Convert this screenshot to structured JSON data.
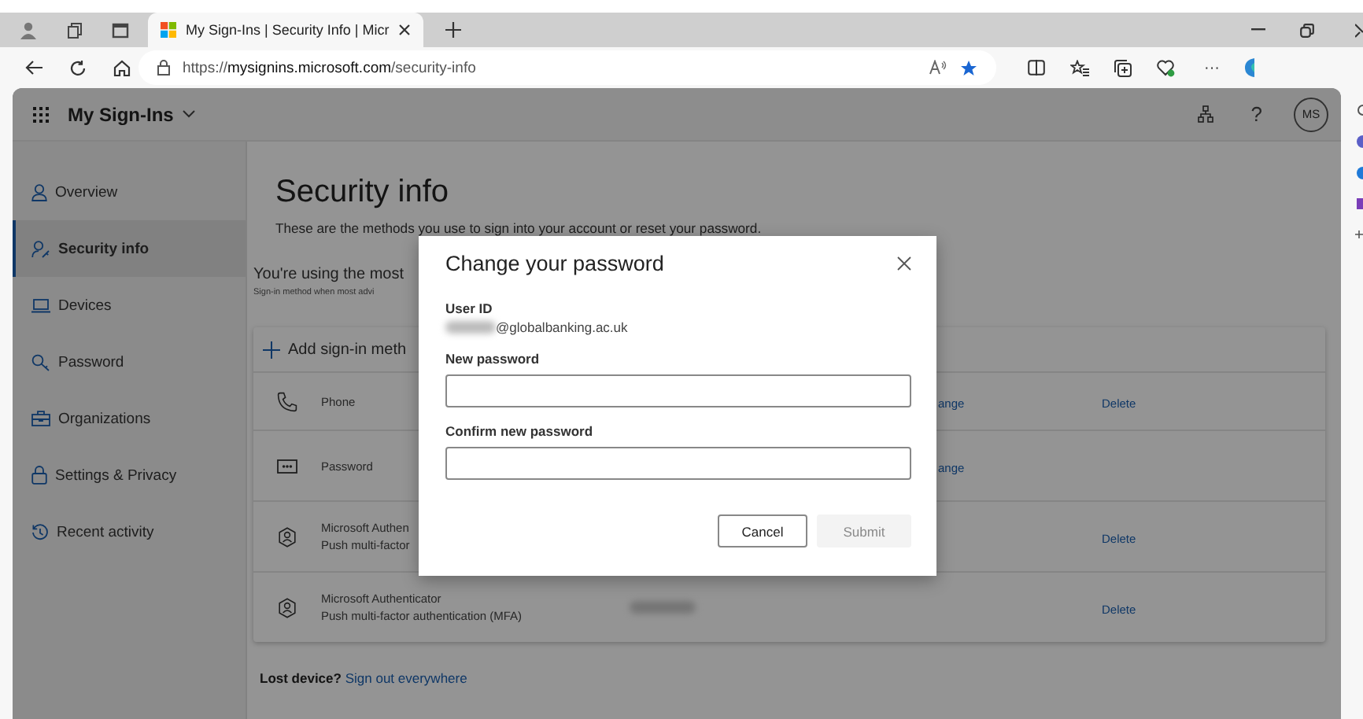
{
  "browser": {
    "tabs": [
      {
        "title": "My Sign-Ins | Security Info | Micr",
        "selected": true
      }
    ],
    "address": "https://**mysignins.microsoft.com**/security-info",
    "more": "···"
  },
  "header": {
    "app_name": "My Sign-Ins",
    "help": "?",
    "avatar": "MS"
  },
  "sidebar": {
    "items": [
      {
        "kind": "person",
        "label": "Overview",
        "selected": false
      },
      {
        "kind": "security",
        "label": "Security info",
        "selected": true
      },
      {
        "kind": "laptop",
        "label": "Devices",
        "selected": false
      },
      {
        "kind": "key",
        "label": "Password",
        "selected": false
      },
      {
        "kind": "briefcase",
        "label": "Organizations",
        "selected": false
      },
      {
        "kind": "lock",
        "label": "Settings & Privacy",
        "selected": false
      },
      {
        "kind": "history",
        "label": "Recent activity",
        "selected": false
      }
    ]
  },
  "page": {
    "title": "Security info",
    "description": "These are the methods you use to sign into your account or reset your password.",
    "notice": "You're using the most",
    "notice_sub": "Sign-in method when most advi",
    "add_method": "Add sign-in meth",
    "methods": [
      {
        "kind": "phone",
        "lines": [
          "Phone"
        ],
        "change": "ange",
        "delete": "Delete"
      },
      {
        "kind": "password",
        "lines": [
          "Password"
        ],
        "change": "ange"
      },
      {
        "kind": "authenticator",
        "lines": [
          "Microsoft Authen",
          "Push multi-factor"
        ],
        "delete": "Delete"
      },
      {
        "kind": "authenticator",
        "lines": [
          "Microsoft Authenticator",
          "Push multi-factor authentication (MFA)"
        ],
        "redacted": true,
        "delete": "Delete"
      }
    ],
    "lost_device": "Lost device?",
    "sign_out": "Sign out everywhere"
  },
  "dialog": {
    "title": "Change your password",
    "user_id_label": "User ID",
    "user_id_value": "@globalbanking.ac.uk",
    "fields": [
      {
        "label": "New password"
      },
      {
        "label": "Confirm new password"
      }
    ],
    "buttons": [
      {
        "label": "Cancel",
        "disabled": false
      },
      {
        "label": "Submit",
        "disabled": true
      }
    ]
  }
}
